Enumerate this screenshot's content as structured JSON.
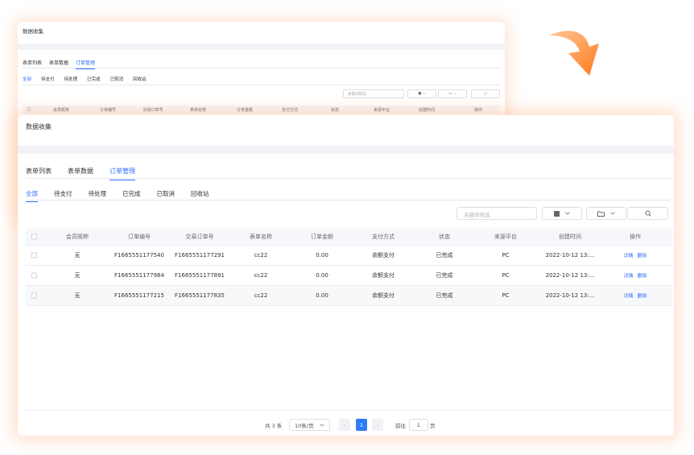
{
  "colors": {
    "accent": "#2f6bff",
    "shadow": "#ff9650",
    "arrow": "#ff8a2e"
  },
  "title": "数据收集",
  "tabs": [
    "表单列表",
    "表单数据",
    "订单管理"
  ],
  "active_tab": 2,
  "subtabs": [
    "全部",
    "待支付",
    "待处理",
    "已完成",
    "已取消",
    "回收站"
  ],
  "active_subtab": 0,
  "search": {
    "placeholder": "关键词筛选"
  },
  "toolbar_icons": [
    "grid-icon",
    "folder-icon",
    "search-icon"
  ],
  "columns": [
    "会员昵称",
    "订单编号",
    "交易订单号",
    "表单名称",
    "订单金额",
    "支付方式",
    "状态",
    "来源平台",
    "创建时间",
    "操作"
  ],
  "rows": [
    {
      "member": "无",
      "order_no": "F1665551177540",
      "trade_no": "F1665551177291",
      "form": "cc22",
      "amount": "0.00",
      "pay": "余额支付",
      "status": "已完成",
      "platform": "PC",
      "created": "2022-10-12 13:...",
      "op_detail": "详情",
      "op_delete": "删除"
    },
    {
      "member": "无",
      "order_no": "F1665551177984",
      "trade_no": "F1665551177891",
      "form": "cc22",
      "amount": "0.00",
      "pay": "余额支付",
      "status": "已完成",
      "platform": "PC",
      "created": "2022-10-12 13:...",
      "op_detail": "详情",
      "op_delete": "删除"
    },
    {
      "member": "无",
      "order_no": "F1665551177215",
      "trade_no": "F1665551177835",
      "form": "cc22",
      "amount": "0.00",
      "pay": "余额支付",
      "status": "已完成",
      "platform": "PC",
      "created": "2022-10-12 13:...",
      "op_detail": "详情",
      "op_delete": "删除"
    }
  ],
  "pagination": {
    "total": "共 3 条",
    "page_size": "10条/页",
    "prev": "‹",
    "next": "›",
    "current": "1",
    "goto_label": "前往",
    "goto_value": "1",
    "page_suffix": "页"
  }
}
